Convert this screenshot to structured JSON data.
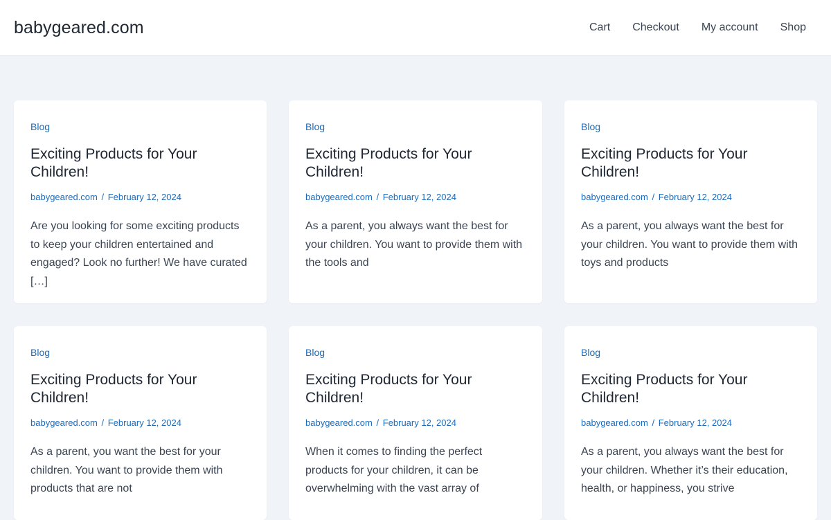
{
  "site": {
    "title": "babygeared.com"
  },
  "nav": [
    {
      "label": "Cart"
    },
    {
      "label": "Checkout"
    },
    {
      "label": "My account"
    },
    {
      "label": "Shop"
    }
  ],
  "posts": [
    {
      "category": "Blog",
      "title": "Exciting Products for Your Children!",
      "author": "babygeared.com",
      "separator": "/",
      "date": "February 12, 2024",
      "excerpt": "Are you looking for some exciting products to keep your children entertained and engaged? Look no further! We have curated […]"
    },
    {
      "category": "Blog",
      "title": "Exciting Products for Your Children!",
      "author": "babygeared.com",
      "separator": "/",
      "date": "February 12, 2024",
      "excerpt": "As a parent, you always want the best for your children. You want to provide them with the tools and"
    },
    {
      "category": "Blog",
      "title": "Exciting Products for Your Children!",
      "author": "babygeared.com",
      "separator": "/",
      "date": "February 12, 2024",
      "excerpt": "As a parent, you always want the best for your children. You want to provide them with toys and products"
    },
    {
      "category": "Blog",
      "title": "Exciting Products for Your Children!",
      "author": "babygeared.com",
      "separator": "/",
      "date": "February 12, 2024",
      "excerpt": "As a parent, you want the best for your children. You want to provide them with products that are not"
    },
    {
      "category": "Blog",
      "title": "Exciting Products for Your Children!",
      "author": "babygeared.com",
      "separator": "/",
      "date": "February 12, 2024",
      "excerpt": "When it comes to finding the perfect products for your children, it can be overwhelming with the vast array of"
    },
    {
      "category": "Blog",
      "title": "Exciting Products for Your Children!",
      "author": "babygeared.com",
      "separator": "/",
      "date": "February 12, 2024",
      "excerpt": "As a parent, you always want the best for your children. Whether it’s their education, health, or happiness, you strive"
    }
  ]
}
